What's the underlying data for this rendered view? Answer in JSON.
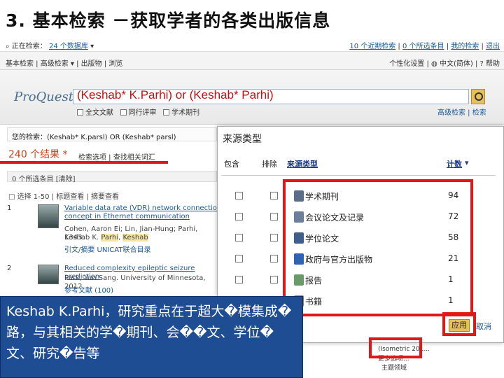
{
  "slide": {
    "title": "3. 基本检索 －获取学者的各类出版信息"
  },
  "topbar": {
    "prefix": "正在检索：",
    "count_link": "24 个数据库",
    "right_links": [
      "10 个近期检索",
      "0 个所选条目",
      "我的检索",
      "退出"
    ]
  },
  "navbar": {
    "left": [
      "基本检索",
      "高级检索",
      "出版物",
      "浏览"
    ],
    "right": [
      "个性化设置",
      "中文(简体)",
      "帮助"
    ]
  },
  "search": {
    "logo": "ProQuest",
    "query": "(Keshab* K.Parhi) or (Keshab* Parhi)",
    "filters": [
      "全文文献",
      "同行评审",
      "学术期刊"
    ],
    "advanced": "高级检索 | 检索"
  },
  "results": {
    "current_search": "您的检索：(Keshab* K.parsl) OR (Keshab* parsl)",
    "count": "240 个结果 *",
    "links": [
      "检索选项",
      "查找相关词汇"
    ],
    "toolbar": "0 个所选条目 [清除]",
    "toolbar2": "□ 选择 1-50   | 标题查看 | 摘要查看",
    "items": [
      {
        "num": "1",
        "title": "Variable data rate (VDR) network connection concept in Ethernet communication",
        "authors": "Cohen, Aaron Ei; Lin, Jian-Hung; Parhi, Keshab K.",
        "hl_parhi": "Parhi",
        "hl_keshab": "Keshab",
        "extra": "1343.",
        "actions": "引文/摘要  UNICAT联合目录"
      },
      {
        "num": "2",
        "title": "Reduced complexity epileptic seizure prediction",
        "authors": "Park, Yun Sang. University of Minnesota, 2012.",
        "actions": "参考文献 (100)"
      }
    ]
  },
  "popup": {
    "title": "来源类型",
    "headers": {
      "include": "包含",
      "exclude": "排除",
      "type": "来源类型",
      "count": "计数"
    },
    "rows": [
      {
        "label": "学术期刊",
        "count": "94",
        "icon_color": "#5a6e8a"
      },
      {
        "label": "会议论文及记录",
        "count": "72",
        "icon_color": "#6b7f9a"
      },
      {
        "label": "学位论文",
        "count": "58",
        "icon_color": "#3f5f8a"
      },
      {
        "label": "政府与官方出版物",
        "count": "21",
        "icon_color": "#2f62b0"
      },
      {
        "label": "报告",
        "count": "1",
        "icon_color": "#6a9a6a"
      },
      {
        "label": "书籍",
        "count": "1",
        "icon_color": "#a77a3a"
      }
    ],
    "apply": "应用",
    "cancel": "取消"
  },
  "lower": {
    "line1": "(Isometric 201...",
    "more": "更多选项...",
    "subject": "主题领域"
  },
  "callout": {
    "text": "Keshab K.Parhi，研究重点在于超大�模集成�路，与其相关的学�期刊、会��文、学位�文、研究�告等"
  }
}
